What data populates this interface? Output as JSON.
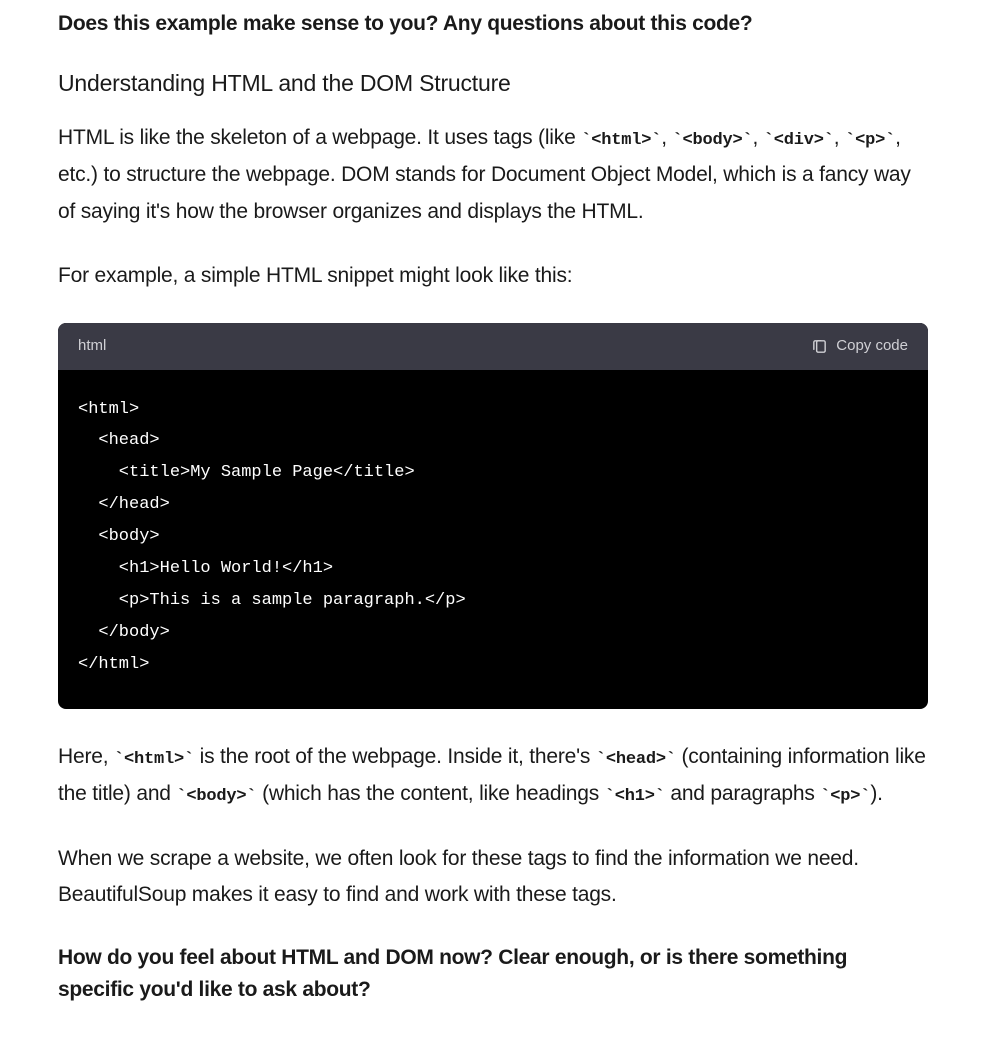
{
  "q1": "Does this example make sense to you? Any questions about this code?",
  "heading1": "Understanding HTML and the DOM Structure",
  "p1_part1": "HTML is like the skeleton of a webpage. It uses tags (like ",
  "p1_tag_html": "`<html>`",
  "p1_sep1": ", ",
  "p1_tag_body": "`<body>`",
  "p1_sep2": ", ",
  "p1_tag_div": "`<div>`",
  "p1_sep3": ", ",
  "p1_tag_p": "`<p>`",
  "p1_part2": ", etc.) to structure the webpage. DOM stands for Document Object Model, which is a fancy way of saying it's how the browser organizes and displays the HTML.",
  "p2": "For example, a simple HTML snippet might look like this:",
  "code_lang": "html",
  "copy_label": "Copy code",
  "code_content": "<html>\n  <head>\n    <title>My Sample Page</title>\n  </head>\n  <body>\n    <h1>Hello World!</h1>\n    <p>This is a sample paragraph.</p>\n  </body>\n</html>",
  "p3_part1": "Here, ",
  "p3_tag_html": "`<html>`",
  "p3_part2": " is the root of the webpage. Inside it, there's ",
  "p3_tag_head": "`<head>`",
  "p3_part3": " (containing information like the title) and ",
  "p3_tag_body": "`<body>`",
  "p3_part4": " (which has the content, like headings ",
  "p3_tag_h1": "`<h1>`",
  "p3_part5": " and paragraphs ",
  "p3_tag_p": "`<p>`",
  "p3_part6": ").",
  "p4": "When we scrape a website, we often look for these tags to find the information we need. BeautifulSoup makes it easy to find and work with these tags.",
  "q2": "How do you feel about HTML and DOM now? Clear enough, or is there something specific you'd like to ask about?"
}
